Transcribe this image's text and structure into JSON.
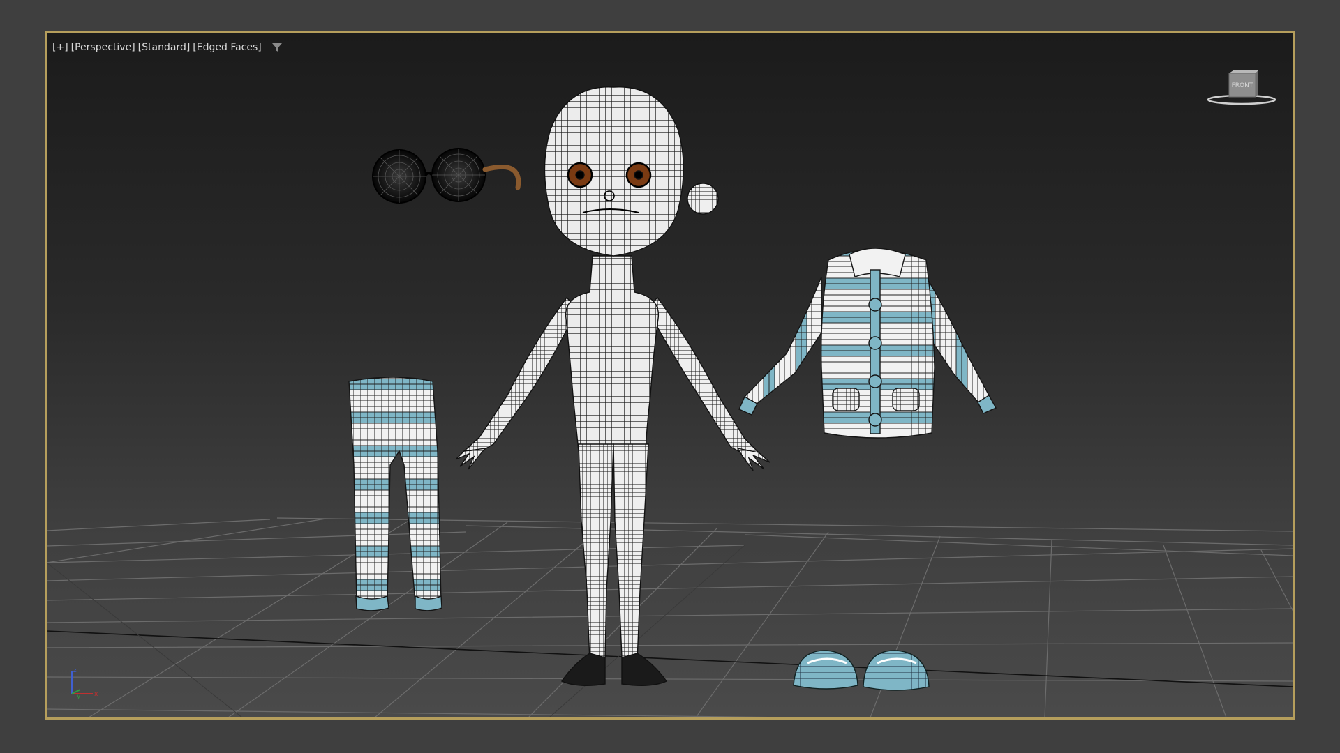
{
  "viewport": {
    "label": {
      "plus": "[+]",
      "view": "[Perspective]",
      "shading": "[Standard]",
      "display": "[Edged Faces]"
    },
    "viewcube_face": "FRONT",
    "axes": {
      "x": "x",
      "y": "y",
      "z": "z"
    },
    "icons": {
      "filter": "filter-funnel-icon",
      "viewcube": "viewcube-icon",
      "axis": "axis-tripod-icon"
    },
    "colors": {
      "active_border": "#b59e5c",
      "wire": "#1a1a1a",
      "mesh": "#eeeeee",
      "cloth_stripe": "#7fb6c6",
      "eye": "#7a3a12",
      "temple": "#8a5a2e",
      "axis_x": "#c03030",
      "axis_y": "#30a040",
      "axis_z": "#4060d0"
    }
  }
}
